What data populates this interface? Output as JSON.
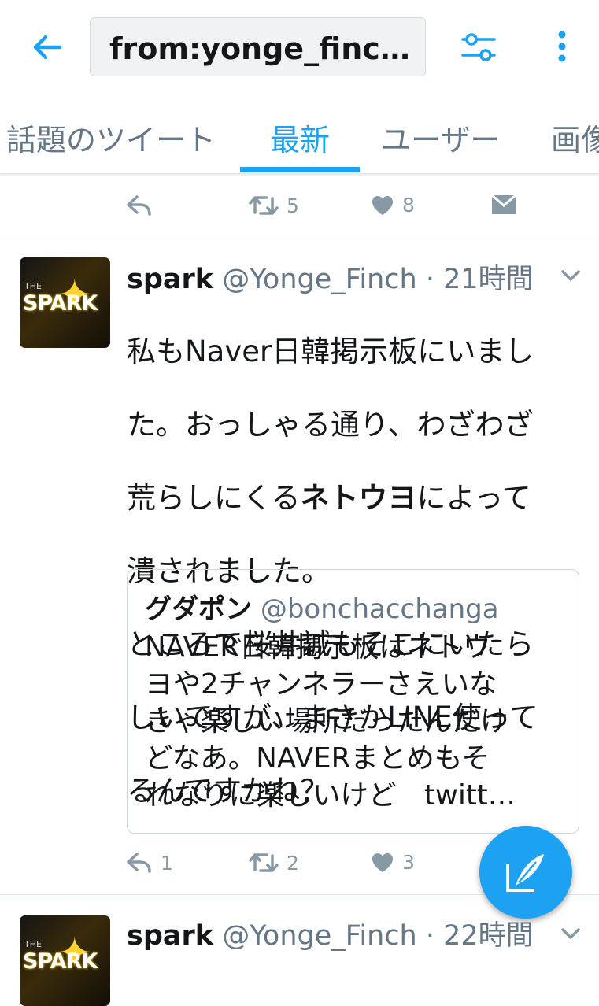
{
  "top_bar": {
    "search_query": "from:yonge_finc…",
    "back_icon": "arrow-left-icon",
    "filter_icon": "sliders-icon",
    "more_icon": "more-vertical-icon"
  },
  "tabs": [
    {
      "label": "話題のツイート",
      "active": false
    },
    {
      "label": "最新",
      "active": true
    },
    {
      "label": "ユーザー",
      "active": false
    },
    {
      "label": "画像",
      "active": false
    }
  ],
  "prev_tweet_actions": {
    "retweet_count": "5",
    "like_count": "8"
  },
  "tweet1": {
    "name": "spark",
    "handle": "@Yonge_Finch",
    "time": "· 21時間",
    "text_lines": [
      {
        "before": "私もNaver日韓掲示板にいまし",
        "bold": "",
        "after": ""
      },
      {
        "before": "た。おっしゃる通り、わざわざ",
        "bold": "",
        "after": ""
      },
      {
        "before": "荒らしにくる",
        "bold": "ネトウヨ",
        "after": "によって"
      },
      {
        "before": "潰されました。",
        "bold": "",
        "after": ""
      },
      {
        "before": "ところで桜井誠もそこにいたら",
        "bold": "",
        "after": ""
      },
      {
        "before": "しいですが、まさかLINE使って",
        "bold": "",
        "after": ""
      },
      {
        "before": "るんですかね？",
        "bold": "",
        "after": ""
      }
    ],
    "quote": {
      "name": "グダポン",
      "handle": "@bonchacchanga",
      "lines": [
        "NAVER日韓掲示板はネトウ",
        "ヨや2チャンネラーさえいな",
        "きゃ楽しい場所だったんだけ",
        "どなあ。NAVERまとめもそ",
        "れなりに楽しいけど　twitt…"
      ]
    },
    "reply_count": "1",
    "retweet_count": "2",
    "like_count": "3"
  },
  "tweet2": {
    "name": "spark",
    "handle": "@Yonge_Finch",
    "time": "· 22時間"
  },
  "avatar": {
    "small_text": "THE",
    "text": "SPARK"
  },
  "colors": {
    "accent": "#1da1f2",
    "muted": "#8899a6",
    "text": "#14171a"
  }
}
